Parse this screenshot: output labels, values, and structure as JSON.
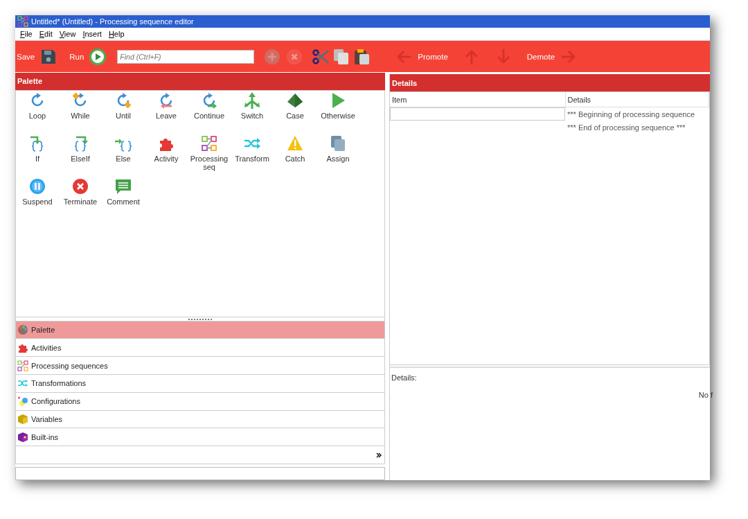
{
  "window": {
    "title": "Untitled* (Untitled) - Processing sequence editor"
  },
  "menu": [
    "File",
    "Edit",
    "View",
    "Insert",
    "Help"
  ],
  "toolbar": [
    {
      "kind": "button",
      "label": "Save",
      "disabled": false
    },
    {
      "kind": "button",
      "label": "Run",
      "disabled": false
    },
    {
      "kind": "search",
      "placeholder": "Find (Ctrl+F)"
    },
    {
      "kind": "button",
      "disabled": true
    },
    {
      "kind": "button",
      "disabled": true
    },
    {
      "kind": "button",
      "disabled": false
    },
    {
      "kind": "button",
      "disabled": false
    },
    {
      "kind": "button",
      "disabled": false
    },
    {
      "kind": "button",
      "label": "Promote",
      "disabled": true
    },
    {
      "kind": "button",
      "disabled": true
    },
    {
      "kind": "button",
      "disabled": true
    },
    {
      "kind": "button",
      "label": "Demote",
      "disabled": true
    }
  ],
  "palette": {
    "title": "Palette",
    "items": [
      "Loop",
      "While",
      "Until",
      "Leave",
      "Continue",
      "Switch",
      "Case",
      "Otherwise",
      "If",
      "ElseIf",
      "Else",
      "Activity",
      "Processing seq",
      "Transform",
      "Catch",
      "Assign",
      "Suspend",
      "Terminate",
      "Comment"
    ]
  },
  "sections": [
    {
      "label": "Palette",
      "selected": true
    },
    {
      "label": "Activities",
      "selected": false
    },
    {
      "label": "Processing sequences",
      "selected": false
    },
    {
      "label": "Transformations",
      "selected": false
    },
    {
      "label": "Configurations",
      "selected": false
    },
    {
      "label": "Variables",
      "selected": false
    },
    {
      "label": "Built-ins",
      "selected": false
    }
  ],
  "details": {
    "title": "Details",
    "columns": [
      "Item",
      "Details"
    ],
    "rows": [
      {
        "item": "",
        "details": "*** Beginning of processing sequence",
        "selected": true
      },
      {
        "item": "",
        "details": "*** End of processing sequence ***",
        "selected": false
      }
    ],
    "footer_label": "Details:",
    "footer_message": "No f"
  }
}
